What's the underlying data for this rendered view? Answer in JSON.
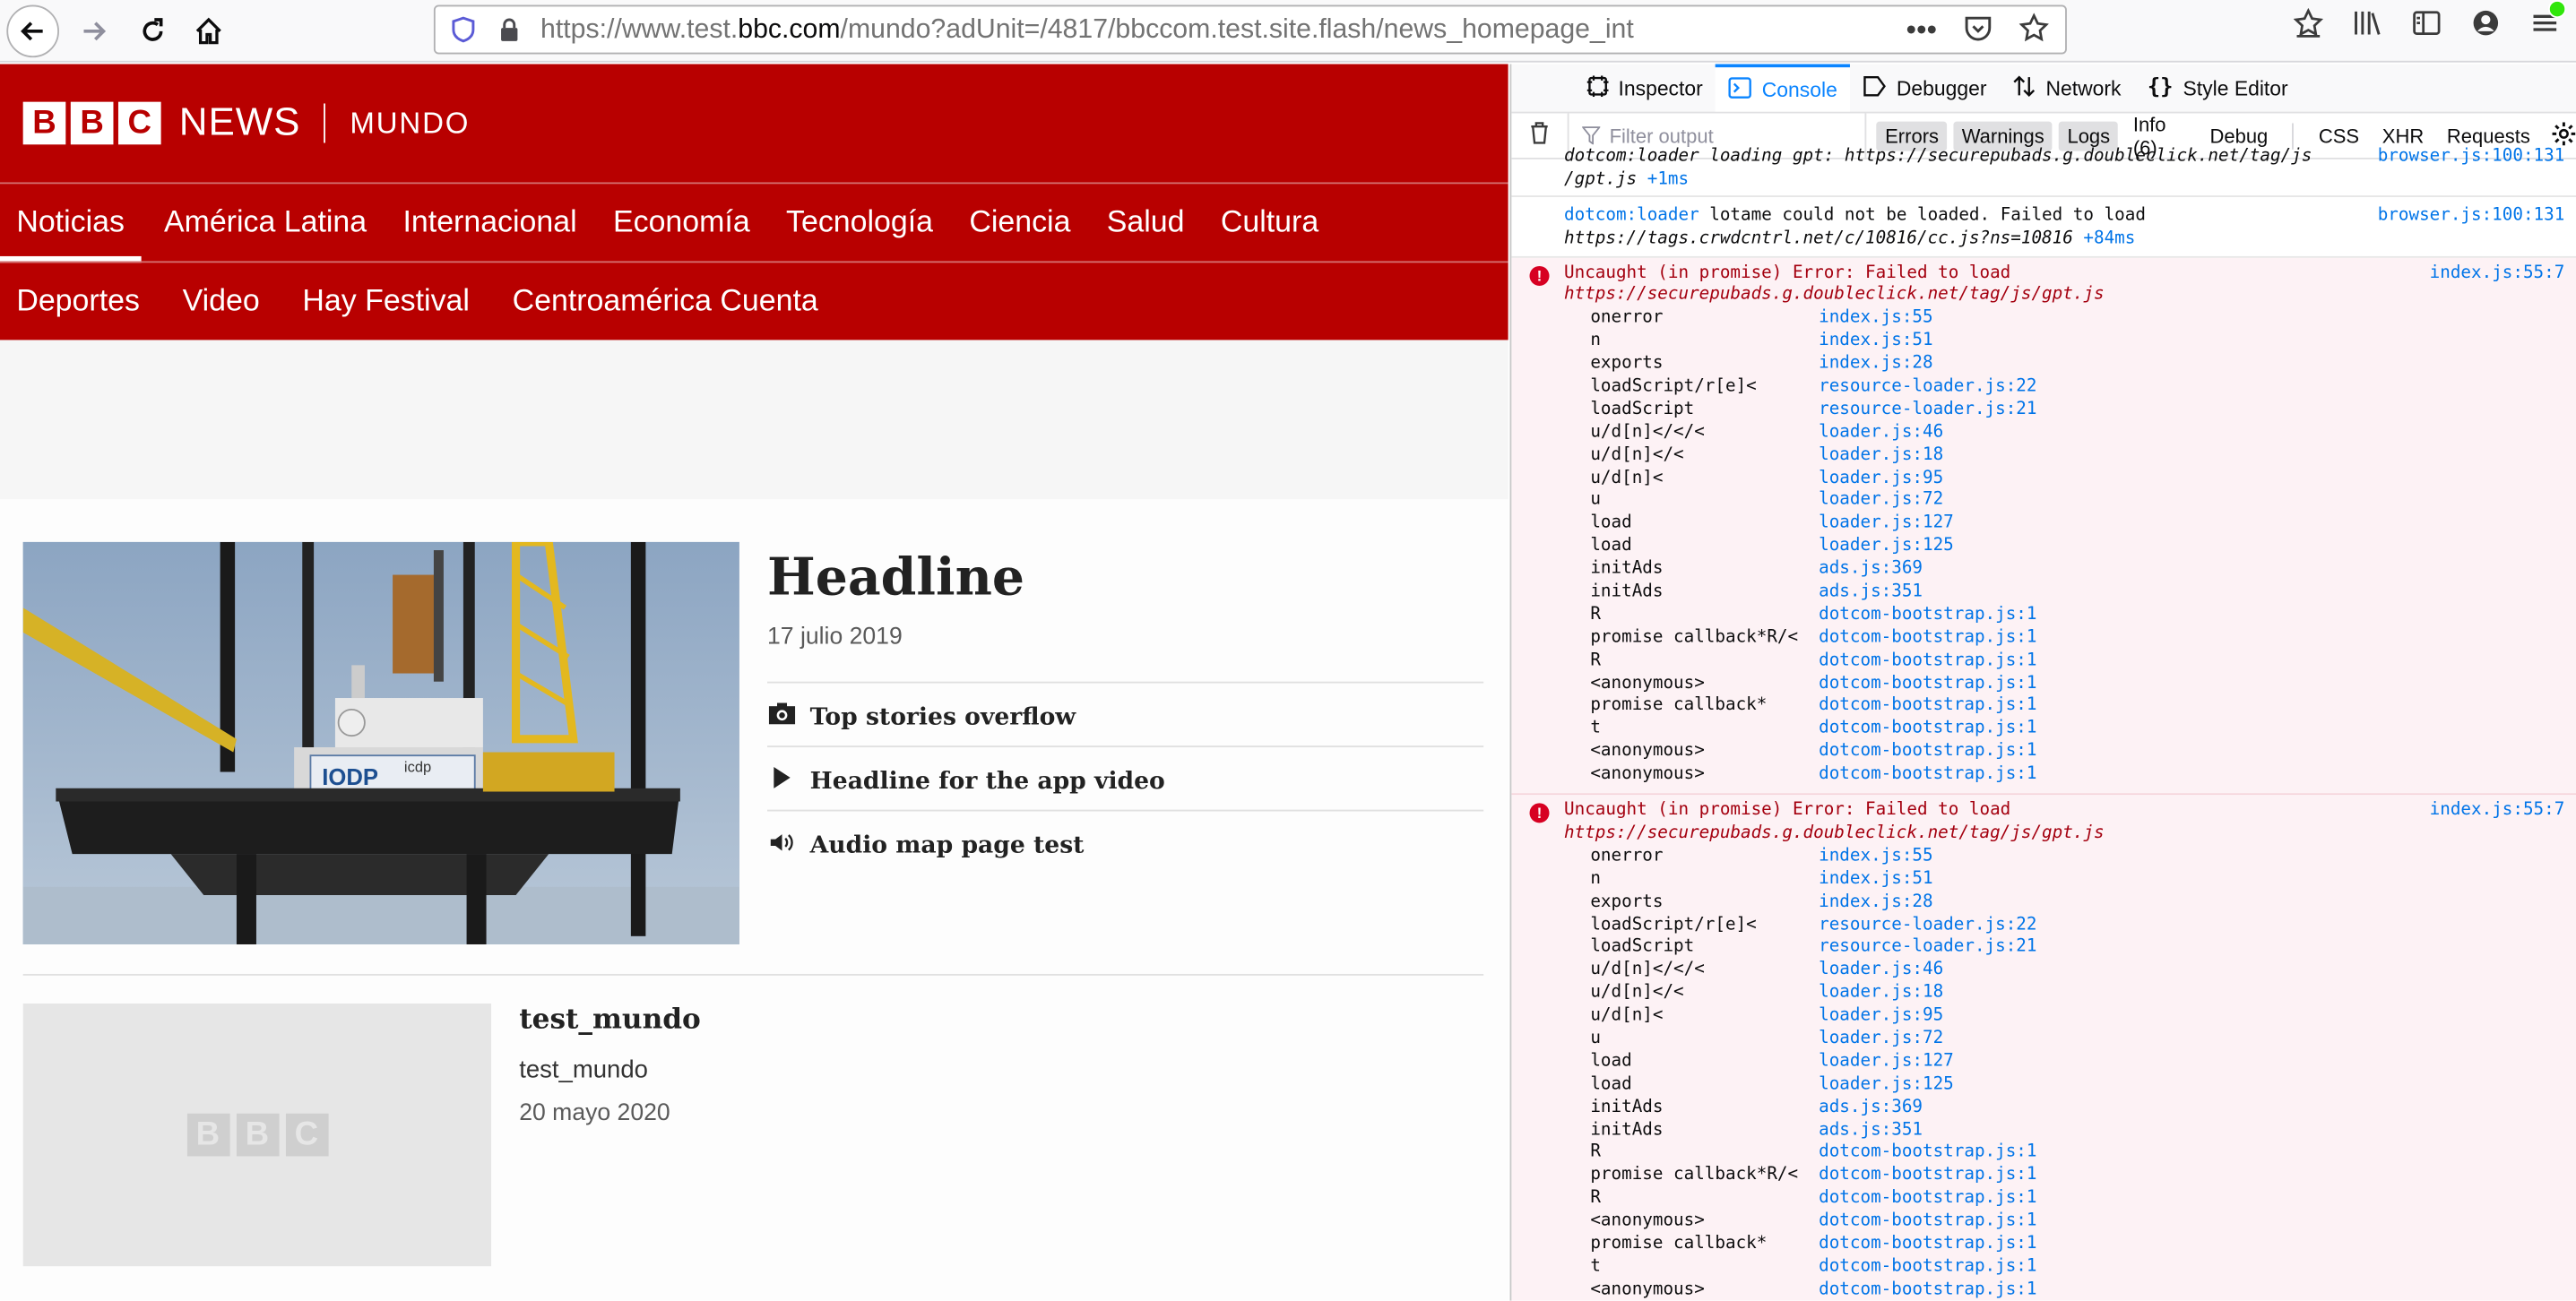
{
  "browser": {
    "url_prefix": "https://www.test.",
    "url_domain": "bbc.com",
    "url_suffix": "/mundo?adUnit=/4817/bbccom.test.site.flash/news_homepage_int"
  },
  "page": {
    "logo_letters": [
      "B",
      "B",
      "C"
    ],
    "logo_news": "NEWS",
    "logo_section": "MUNDO",
    "nav_row1": [
      "Noticias",
      "América Latina",
      "Internacional",
      "Economía",
      "Tecnología",
      "Ciencia",
      "Salud",
      "Cultura"
    ],
    "nav_row2": [
      "Deportes",
      "Video",
      "Hay Festival",
      "Centroamérica Cuenta"
    ],
    "headline": "Headline",
    "headline_date": "17 julio 2019",
    "stories": [
      {
        "icon": "camera-icon",
        "title": "Top stories overflow"
      },
      {
        "icon": "play-icon",
        "title": "Headline for the app video"
      },
      {
        "icon": "speaker-icon",
        "title": "Audio map page test"
      }
    ],
    "image_banner_text": "IODP",
    "image_banner_text2": "icdp",
    "story2_title": "test_mundo",
    "story2_summary": "test_mundo",
    "story2_date": "20 mayo 2020",
    "placeholder_letters": [
      "B",
      "B",
      "C"
    ]
  },
  "devtools": {
    "tabs": [
      {
        "icon": "inspector-icon",
        "label": "Inspector"
      },
      {
        "icon": "console-icon",
        "label": "Console"
      },
      {
        "icon": "debugger-icon",
        "label": "Debugger"
      },
      {
        "icon": "network-icon",
        "label": "Network"
      },
      {
        "icon": "style-editor-icon",
        "label": "Style Editor"
      }
    ],
    "filter_placeholder": "Filter output",
    "filter_buttons": [
      "Errors",
      "Warnings",
      "Logs",
      "Info (6)",
      "Debug"
    ],
    "filter_buttons2": [
      "CSS",
      "XHR",
      "Requests"
    ],
    "log_partial": {
      "line1": "dotcom:loader loading gpt: https://securepubads.g.doubleclick.net/tag/js",
      "line2": "/gpt.js",
      "time": "+1ms",
      "src": "browser.js:100:131"
    },
    "log_lotame": {
      "prefix": "dotcom:loader",
      "text": " lotame could not be loaded. Failed to load",
      "url": "https://tags.crwdcntrl.net/c/10816/cc.js?ns=10816",
      "time": "+84ms",
      "src": "browser.js:100:131"
    },
    "error_title": "Uncaught (in promise) Error: Failed to load",
    "error_url": "https://securepubads.g.doubleclick.net/tag/js/gpt.js",
    "error_src": "index.js:55:7",
    "stack": [
      {
        "fn": "onerror",
        "loc": "index.js:55"
      },
      {
        "fn": "n",
        "loc": "index.js:51"
      },
      {
        "fn": "exports",
        "loc": "index.js:28"
      },
      {
        "fn": "loadScript/r[e]<",
        "loc": "resource-loader.js:22"
      },
      {
        "fn": "loadScript",
        "loc": "resource-loader.js:21"
      },
      {
        "fn": "u/d[n]</</<",
        "loc": "loader.js:46"
      },
      {
        "fn": "u/d[n]</<",
        "loc": "loader.js:18"
      },
      {
        "fn": "u/d[n]<",
        "loc": "loader.js:95"
      },
      {
        "fn": "u",
        "loc": "loader.js:72"
      },
      {
        "fn": "load",
        "loc": "loader.js:127"
      },
      {
        "fn": "load",
        "loc": "loader.js:125"
      },
      {
        "fn": "initAds",
        "loc": "ads.js:369"
      },
      {
        "fn": "initAds",
        "loc": "ads.js:351"
      },
      {
        "fn": "R",
        "loc": "dotcom-bootstrap.js:1"
      },
      {
        "fn": "promise callback*R/<",
        "loc": "dotcom-bootstrap.js:1"
      },
      {
        "fn": "R",
        "loc": "dotcom-bootstrap.js:1"
      },
      {
        "fn": "<anonymous>",
        "loc": "dotcom-bootstrap.js:1"
      },
      {
        "fn": "promise callback*",
        "loc": "dotcom-bootstrap.js:1"
      },
      {
        "fn": "t",
        "loc": "dotcom-bootstrap.js:1"
      },
      {
        "fn": "<anonymous>",
        "loc": "dotcom-bootstrap.js:1"
      },
      {
        "fn": "<anonymous>",
        "loc": "dotcom-bootstrap.js:1"
      }
    ]
  }
}
